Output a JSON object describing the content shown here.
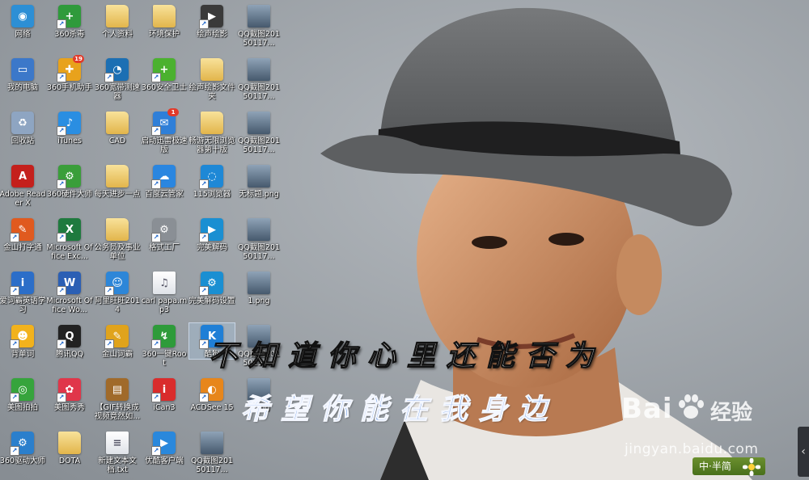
{
  "desktop": {
    "icons": [
      {
        "label": "网络",
        "icon": "network-icon",
        "kind": "app",
        "color": "#2d8fd5",
        "glyph": "◉",
        "shortcut": false
      },
      {
        "label": "360杀毒",
        "icon": "360-antivirus-icon",
        "kind": "app",
        "color": "#2f9a3b",
        "glyph": "+",
        "shortcut": true
      },
      {
        "label": "个人资料",
        "icon": "folder-icon",
        "kind": "folder",
        "shortcut": false
      },
      {
        "label": "环境保护",
        "icon": "folder-icon",
        "kind": "folder",
        "shortcut": false
      },
      {
        "label": "绘声绘影",
        "icon": "video-editor-icon",
        "kind": "app",
        "color": "#3a3a3a",
        "glyph": "▶",
        "shortcut": true
      },
      {
        "label": "QQ截图20150117...",
        "icon": "image-file-icon",
        "kind": "shot",
        "shortcut": false
      },
      {
        "label": "我的电脑",
        "icon": "computer-icon",
        "kind": "app",
        "color": "#3c78c9",
        "glyph": "▭",
        "shortcut": false
      },
      {
        "label": "360手机助手",
        "icon": "360-phone-assistant-icon",
        "kind": "app",
        "color": "#e8a21c",
        "glyph": "✚",
        "shortcut": true,
        "badge": "19"
      },
      {
        "label": "360宽带测速器",
        "icon": "speed-test-icon",
        "kind": "app",
        "color": "#1c6fb3",
        "glyph": "◔",
        "shortcut": true
      },
      {
        "label": "360安全卫士",
        "icon": "360-security-icon",
        "kind": "app",
        "color": "#4bb12f",
        "glyph": "+",
        "shortcut": true
      },
      {
        "label": "绘声绘影文件夹",
        "icon": "folder-icon",
        "kind": "folder",
        "shortcut": false
      },
      {
        "label": "QQ截图20150117...",
        "icon": "image-file-icon",
        "kind": "shot",
        "shortcut": false
      },
      {
        "label": "回收站",
        "icon": "recycle-bin-icon",
        "kind": "app",
        "color": "#8ea5c2",
        "glyph": "♻",
        "shortcut": false
      },
      {
        "label": "iTunes",
        "icon": "itunes-icon",
        "kind": "app",
        "color": "#2a8ee2",
        "glyph": "♪",
        "shortcut": true
      },
      {
        "label": "CAD",
        "icon": "folder-icon",
        "kind": "folder",
        "shortcut": false
      },
      {
        "label": "启动迅雷极速版",
        "icon": "thunder-icon",
        "kind": "app",
        "color": "#2f7fd8",
        "glyph": "✉",
        "shortcut": true,
        "badge": "1"
      },
      {
        "label": "畅游无限浏览器第十版",
        "icon": "folder-icon",
        "kind": "folder",
        "shortcut": false
      },
      {
        "label": "QQ截图20150117...",
        "icon": "image-file-icon",
        "kind": "shot",
        "shortcut": false
      },
      {
        "label": "Adobe Reader X",
        "icon": "adobe-reader-icon",
        "kind": "app",
        "color": "#c4201c",
        "glyph": "A",
        "shortcut": false
      },
      {
        "label": "360硬件大师",
        "icon": "hardware-master-icon",
        "kind": "app",
        "color": "#3a9e3a",
        "glyph": "⚙",
        "shortcut": true
      },
      {
        "label": "每天进步一点",
        "icon": "folder-icon",
        "kind": "folder",
        "shortcut": false
      },
      {
        "label": "百度云管家",
        "icon": "baidu-cloud-icon",
        "kind": "app",
        "color": "#2a86e0",
        "glyph": "☁",
        "shortcut": true
      },
      {
        "label": "115浏览器",
        "icon": "browser-115-icon",
        "kind": "app",
        "color": "#1e88d6",
        "glyph": "◌",
        "shortcut": true
      },
      {
        "label": "无标题.png",
        "icon": "image-file-icon",
        "kind": "shot",
        "shortcut": false
      },
      {
        "label": "金山打字通",
        "icon": "typing-icon",
        "kind": "app",
        "color": "#e05a1f",
        "glyph": "✎",
        "shortcut": true
      },
      {
        "label": "Microsoft Office Exc...",
        "icon": "excel-icon",
        "kind": "app",
        "color": "#1f7a3e",
        "glyph": "X",
        "shortcut": true
      },
      {
        "label": "公务员及事业单位",
        "icon": "folder-icon",
        "kind": "folder",
        "shortcut": false
      },
      {
        "label": "格式工厂",
        "icon": "format-factory-icon",
        "kind": "app",
        "color": "#8a8f95",
        "glyph": "⚙",
        "shortcut": true
      },
      {
        "label": "完美解码",
        "icon": "decoder-icon",
        "kind": "app",
        "color": "#1a8fd2",
        "glyph": "▶",
        "shortcut": true
      },
      {
        "label": "QQ截图20150117...",
        "icon": "image-file-icon",
        "kind": "shot",
        "shortcut": false
      },
      {
        "label": "爱词霸英语学习",
        "icon": "iciba-icon",
        "kind": "app",
        "color": "#2c6ec8",
        "glyph": "i",
        "shortcut": true
      },
      {
        "label": "Microsoft Office Wo...",
        "icon": "word-icon",
        "kind": "app",
        "color": "#2b5fb4",
        "glyph": "W",
        "shortcut": true
      },
      {
        "label": "阿里旺旺2014",
        "icon": "aliwangwang-icon",
        "kind": "app",
        "color": "#2d86d8",
        "glyph": "☺",
        "shortcut": true
      },
      {
        "label": "carl papa.mp3",
        "icon": "audio-file-icon",
        "kind": "file",
        "glyph": "♫",
        "shortcut": false
      },
      {
        "label": "完美解码设置",
        "icon": "decoder-settings-icon",
        "kind": "app",
        "color": "#1a8fd2",
        "glyph": "⚙",
        "shortcut": true
      },
      {
        "label": "1.png",
        "icon": "image-file-icon",
        "kind": "shot",
        "shortcut": false
      },
      {
        "label": "背单词",
        "icon": "vocabulary-icon",
        "kind": "app",
        "color": "#f2b21c",
        "glyph": "☻",
        "shortcut": true
      },
      {
        "label": "腾讯QQ",
        "icon": "qq-icon",
        "kind": "app",
        "color": "#222222",
        "glyph": "Q",
        "shortcut": true
      },
      {
        "label": "金山词霸",
        "icon": "powerword-icon",
        "kind": "app",
        "color": "#e0a31c",
        "glyph": "✎",
        "shortcut": true
      },
      {
        "label": "360一键Root",
        "icon": "root-icon",
        "kind": "app",
        "color": "#2e9b3a",
        "glyph": "↯",
        "shortcut": true
      },
      {
        "label": "酷狗",
        "icon": "kugou-icon",
        "kind": "app",
        "color": "#1f7fd6",
        "glyph": "K",
        "shortcut": true,
        "selected": true
      },
      {
        "label": "QQ截图20150117...",
        "icon": "image-file-icon",
        "kind": "shot",
        "shortcut": false
      },
      {
        "label": "美图拍拍",
        "icon": "meitu-camera-icon",
        "kind": "app",
        "color": "#36a43c",
        "glyph": "◎",
        "shortcut": true
      },
      {
        "label": "美图秀秀",
        "icon": "meitu-xiuxiu-icon",
        "kind": "app",
        "color": "#e0364a",
        "glyph": "✿",
        "shortcut": true
      },
      {
        "label": "【GIF转换成视频竟然如...",
        "icon": "winrar-icon",
        "kind": "app",
        "color": "#a06a2a",
        "glyph": "▤",
        "shortcut": false
      },
      {
        "label": "iCan3",
        "icon": "ican-icon",
        "kind": "app",
        "color": "#d92c2c",
        "glyph": "i",
        "shortcut": true
      },
      {
        "label": "ACDSee 15",
        "icon": "acdsee-icon",
        "kind": "app",
        "color": "#e7861b",
        "glyph": "◐",
        "shortcut": true
      },
      {
        "label": "2.png",
        "icon": "image-file-icon",
        "kind": "shot",
        "shortcut": false
      },
      {
        "label": "360驱动大师",
        "icon": "driver-master-icon",
        "kind": "app",
        "color": "#2b7fcc",
        "glyph": "⚙",
        "shortcut": true
      },
      {
        "label": "DOTA",
        "icon": "folder-icon",
        "kind": "folder",
        "shortcut": false
      },
      {
        "label": "新建文本文档.txt",
        "icon": "text-file-icon",
        "kind": "file",
        "glyph": "≡",
        "shortcut": false
      },
      {
        "label": "优酷客户端",
        "icon": "youku-icon",
        "kind": "app",
        "color": "#2a88dc",
        "glyph": "▶",
        "shortcut": true
      },
      {
        "label": "QQ截图20150117...",
        "icon": "image-file-icon",
        "kind": "shot",
        "shortcut": false
      }
    ]
  },
  "wallpaper": {
    "lyric_line1": "不知道你心里还能否为",
    "lyric_line2": "希望你能在我身边"
  },
  "watermark": {
    "brand": "Bai",
    "brand_cn": "经验",
    "url": "jingyan.baidu.com"
  },
  "ime": {
    "label": "中·半简"
  },
  "side_handle": {
    "glyph": "‹"
  }
}
